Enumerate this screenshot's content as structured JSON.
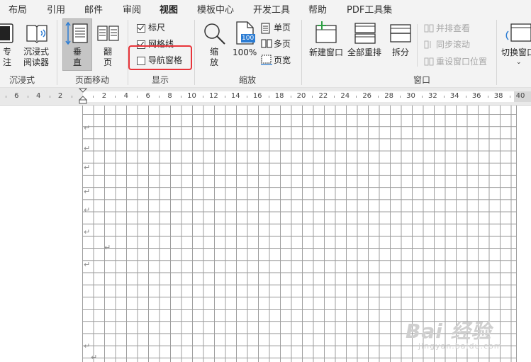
{
  "menu_tabs": [
    "布局",
    "引用",
    "邮件",
    "审阅",
    "视图",
    "模板中心",
    "开发工具",
    "帮助",
    "PDF工具集"
  ],
  "active_tab": "视图",
  "ribbon": {
    "immersive": {
      "focus_label_line1": "专",
      "focus_label_line2": "注",
      "reader_label_line1": "沉浸式",
      "reader_label_line2": "阅读器",
      "group_label": "沉浸式"
    },
    "page_movement": {
      "vertical_line1": "垂",
      "vertical_line2": "直",
      "flip_line1": "翻",
      "flip_line2": "页",
      "group_label": "页面移动"
    },
    "show": {
      "ruler_label": "标尺",
      "ruler_checked": true,
      "gridlines_label": "网格线",
      "gridlines_checked": true,
      "nav_pane_label": "导航窗格",
      "nav_pane_checked": false,
      "group_label": "显示"
    },
    "zoom": {
      "zoom_line1": "缩",
      "zoom_line2": "放",
      "hundred_percent_label": "100%",
      "hundred_icon_text": "100",
      "one_page_label": "单页",
      "multiple_pages_label": "多页",
      "page_width_label": "页宽",
      "group_label": "缩放"
    },
    "window": {
      "new_window_label": "新建窗口",
      "arrange_all_label": "全部重排",
      "split_label": "拆分",
      "side_by_side_label": "并排查看",
      "sync_scroll_label": "同步滚动",
      "reset_position_label": "重设窗口位置",
      "switch_window_label": "切换窗口",
      "group_label": "窗口"
    }
  },
  "ruler": {
    "left_numbers": [
      "6",
      "4",
      "2"
    ],
    "right_numbers": [
      "2",
      "4",
      "6",
      "8",
      "10",
      "12",
      "14",
      "16",
      "18",
      "20",
      "22",
      "24",
      "26",
      "28",
      "30",
      "32",
      "34",
      "36",
      "38",
      "40"
    ]
  },
  "paragraph_mark": "↵",
  "watermark": {
    "main": "Bai 经验",
    "sub": "jingyan.baidu.com"
  },
  "colors": {
    "highlight_box": "#e8343a",
    "active_tab_underline": "#2b579a",
    "icon_blue": "#2b7cd3",
    "icon_green": "#2f9e44",
    "gridline": "#9e9e9e"
  }
}
